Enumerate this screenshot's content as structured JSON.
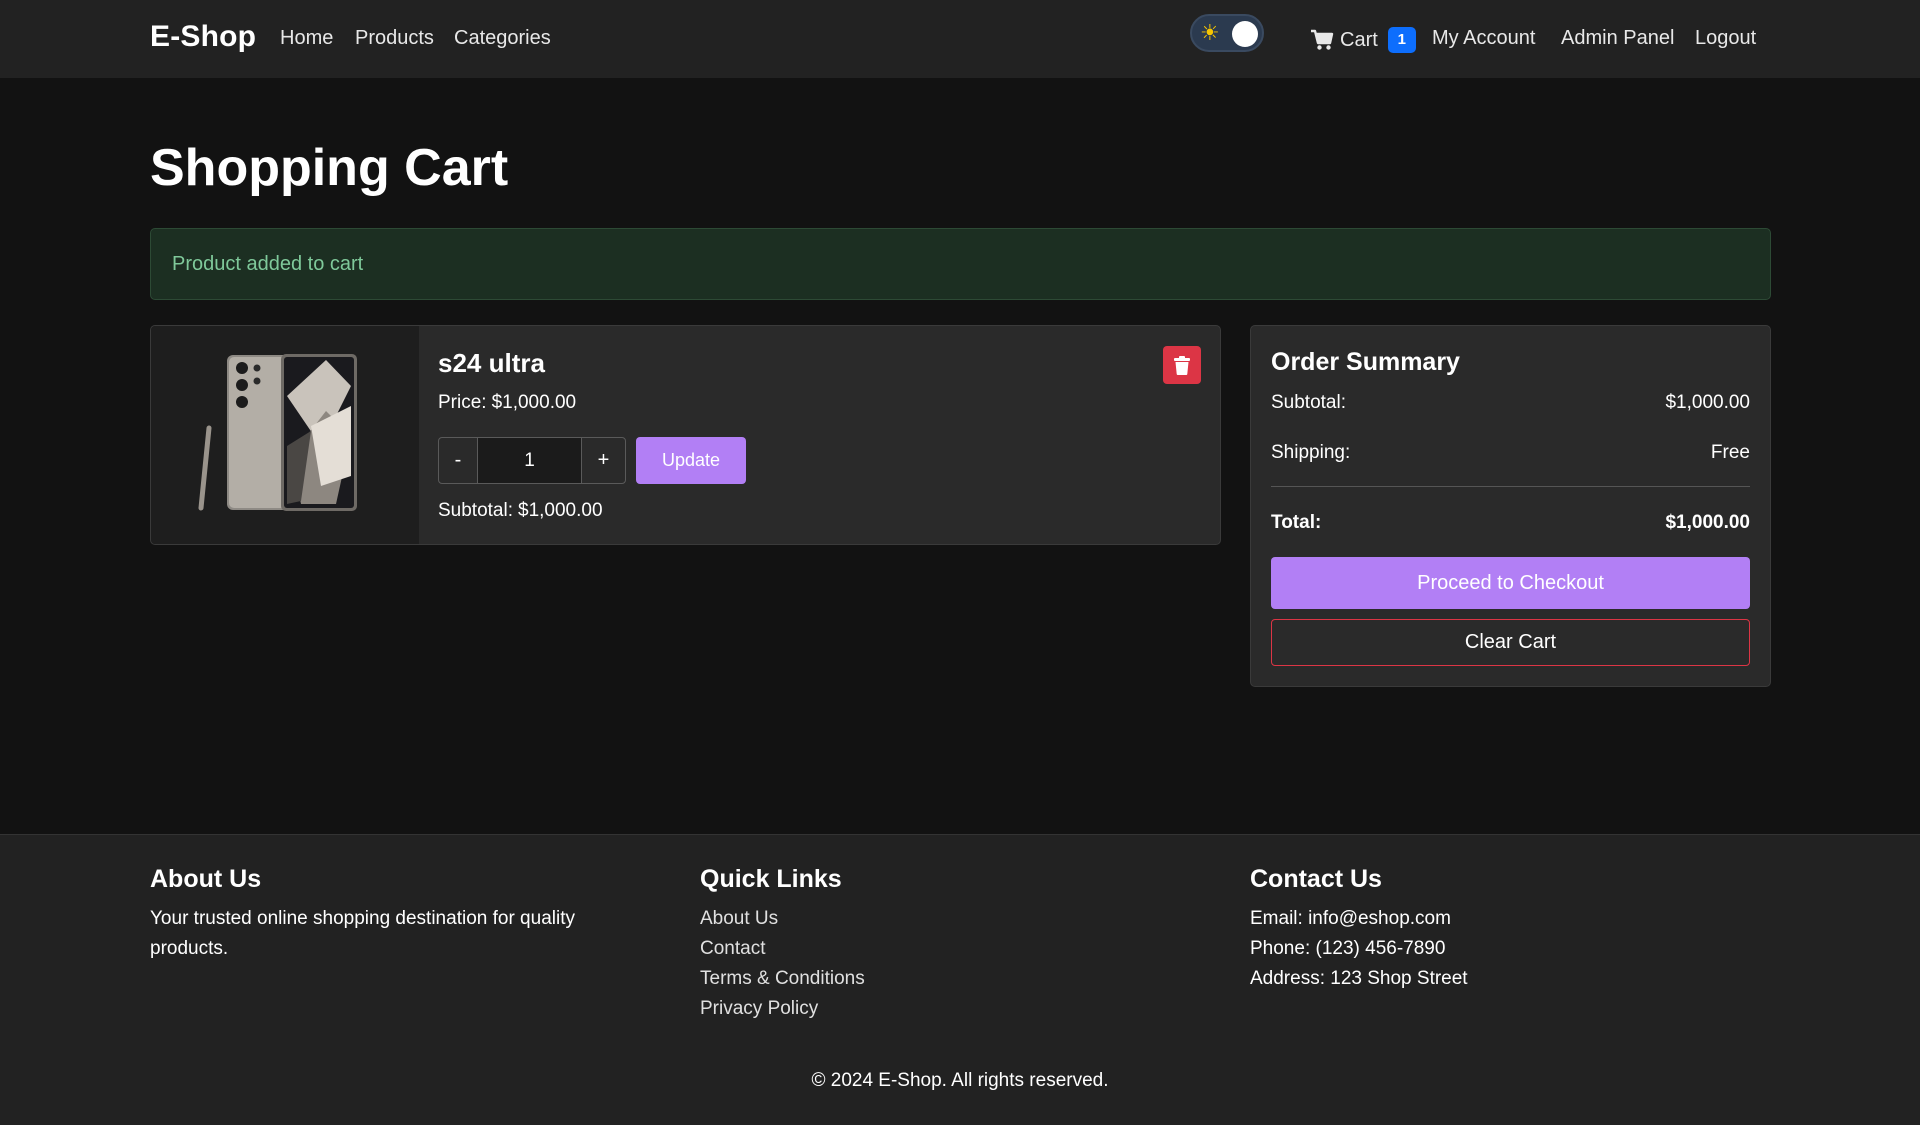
{
  "nav": {
    "brand": "E-Shop",
    "links": [
      "Home",
      "Products",
      "Categories"
    ],
    "theme_toggle_icon": "sun-icon",
    "cart_label": "Cart",
    "cart_count": "1",
    "account": "My Account",
    "admin": "Admin Panel",
    "logout": "Logout"
  },
  "page": {
    "title": "Shopping Cart",
    "alert": "Product added to cart"
  },
  "cart_item": {
    "name": "s24 ultra",
    "price_label": "Price:",
    "price": "$1,000.00",
    "quantity": "1",
    "minus": "-",
    "plus": "+",
    "update_label": "Update",
    "subtotal_label": "Subtotal:",
    "subtotal": "$1,000.00",
    "image_icon": "phone-product-image",
    "delete_icon": "trash-icon"
  },
  "summary": {
    "title": "Order Summary",
    "subtotal_label": "Subtotal:",
    "subtotal": "$1,000.00",
    "shipping_label": "Shipping:",
    "shipping": "Free",
    "total_label": "Total:",
    "total": "$1,000.00",
    "checkout_label": "Proceed to Checkout",
    "clear_label": "Clear Cart"
  },
  "footer": {
    "about_title": "About Us",
    "about_text": "Your trusted online shopping destination for quality products.",
    "links_title": "Quick Links",
    "links": [
      "About Us",
      "Contact",
      "Terms & Conditions",
      "Privacy Policy"
    ],
    "contact_title": "Contact Us",
    "email": "Email: info@eshop.com",
    "phone": "Phone: (123) 456-7890",
    "address": "Address: 123 Shop Street",
    "copyright": "© 2024 E-Shop. All rights reserved."
  },
  "colors": {
    "accent": "#b27ff5",
    "danger": "#dc3545",
    "badge": "#0d6efd",
    "alert_bg": "#1c2f22",
    "alert_text": "#7fc99a"
  }
}
